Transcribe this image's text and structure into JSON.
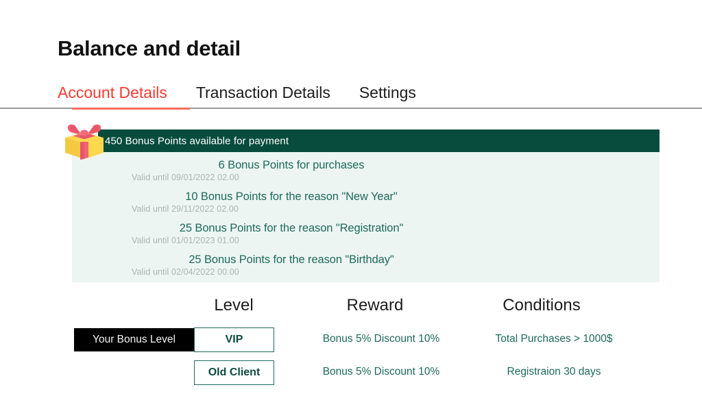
{
  "header": {
    "title": "Balance and detail"
  },
  "tabs": [
    {
      "label": "Account Details",
      "active": true
    },
    {
      "label": "Transaction Details",
      "active": false
    },
    {
      "label": "Settings",
      "active": false
    }
  ],
  "bonus_panel": {
    "icon": "gift-icon",
    "banner_text": "450 Bonus Points available for payment",
    "items": [
      {
        "title": "6 Bonus Points for purchases",
        "valid": "Valid until 09/01/2022 02.00"
      },
      {
        "title": "10 Bonus Points for the reason \"New Year\"",
        "valid": "Valid until 29/11/2022 02.00"
      },
      {
        "title": "25 Bonus Points for the reason \"Registration\"",
        "valid": "Valid until 01/01/2023 01.00"
      },
      {
        "title": "25 Bonus Points for the reason \"Birthday\"",
        "valid": "Valid until 02/04/2022 00.00"
      }
    ]
  },
  "level_table": {
    "columns": [
      "Level",
      "Reward",
      "Conditions"
    ],
    "your_level_label": "Your Bonus Level",
    "rows": [
      {
        "level": "VIP",
        "reward": "Bonus 5% Discount 10%",
        "conditions": "Total Purchases > 1000$",
        "is_current": true
      },
      {
        "level": "Old Client",
        "reward": "Bonus 5% Discount 10%",
        "conditions": "Registraion 30 days",
        "is_current": false
      }
    ]
  },
  "colors": {
    "accent_red": "#fb3a31",
    "banner_green": "#084c3e",
    "panel_mint": "#edf5f2",
    "text_green": "#1d6a5a",
    "badge_black": "#000000"
  }
}
